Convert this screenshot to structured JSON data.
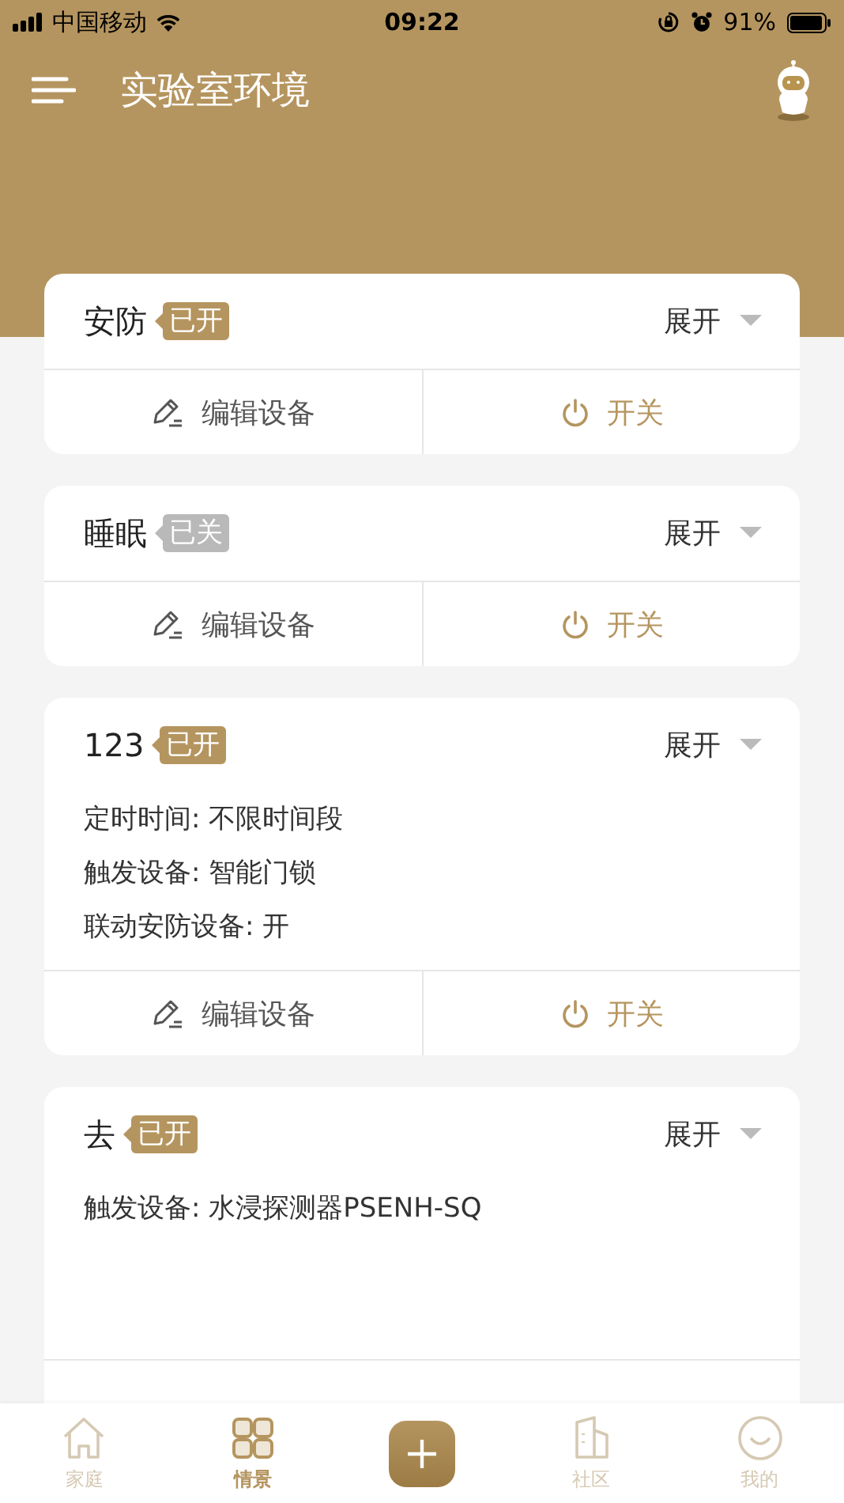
{
  "status_bar": {
    "carrier": "中国移动",
    "time": "09:22",
    "battery": "91%"
  },
  "header": {
    "title": "实验室环境"
  },
  "scenes": [
    {
      "name": "安防",
      "badge": "已开",
      "on": true,
      "expand": "展开",
      "edit": "编辑设备",
      "toggle": "开关"
    },
    {
      "name": "睡眠",
      "badge": "已关",
      "on": false,
      "expand": "展开",
      "edit": "编辑设备",
      "toggle": "开关"
    },
    {
      "name": "123",
      "badge": "已开",
      "on": true,
      "expand": "展开",
      "details": [
        "定时时间: 不限时间段",
        "触发设备: 智能门锁",
        "联动安防设备: 开"
      ],
      "edit": "编辑设备",
      "toggle": "开关"
    },
    {
      "name": "去",
      "badge": "已开",
      "on": true,
      "expand": "展开",
      "details": [
        "触发设备: 水浸探测器PSENH-SQ"
      ]
    }
  ],
  "tab_bar": [
    {
      "kind": "home",
      "label": "家庭",
      "selected": false
    },
    {
      "kind": "scenes",
      "label": "情景",
      "selected": true
    },
    {
      "kind": "add"
    },
    {
      "kind": "community",
      "label": "社区",
      "selected": false
    },
    {
      "kind": "me",
      "label": "我的",
      "selected": false
    }
  ]
}
